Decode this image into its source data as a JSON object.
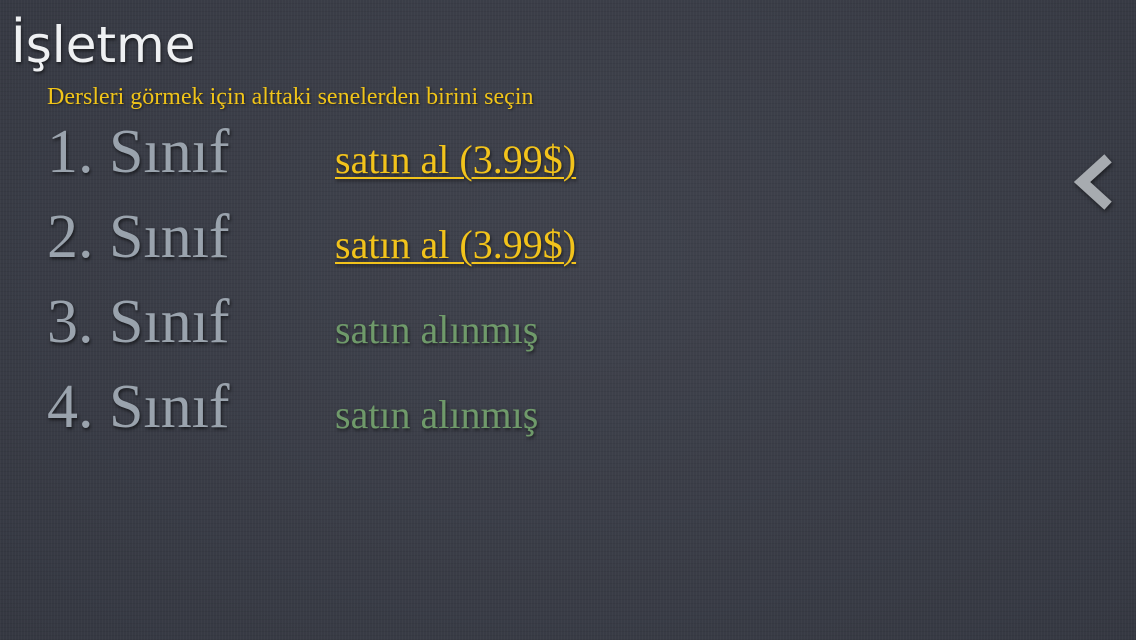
{
  "header": {
    "title": "İşletme",
    "subtitle": "Dersleri görmek için alttaki senelerden birini seçin"
  },
  "grades": [
    {
      "label": "1. Sınıf",
      "status": "satın al (3.99$)",
      "purchased": false
    },
    {
      "label": "2. Sınıf",
      "status": "satın al (3.99$)",
      "purchased": false
    },
    {
      "label": "3. Sınıf",
      "status": "satın alınmış",
      "purchased": true
    },
    {
      "label": "4. Sınıf",
      "status": "satın alınmış",
      "purchased": true
    }
  ],
  "nav": {
    "back_icon": "chevron-left-icon"
  },
  "colors": {
    "background": "#3a3d47",
    "title": "#eef0f2",
    "subtitle": "#f0c419",
    "grade_label": "#9aa3ad",
    "buy_link": "#f2c31b",
    "owned": "#6f9a6a",
    "back_icon": "#a7abb0"
  }
}
